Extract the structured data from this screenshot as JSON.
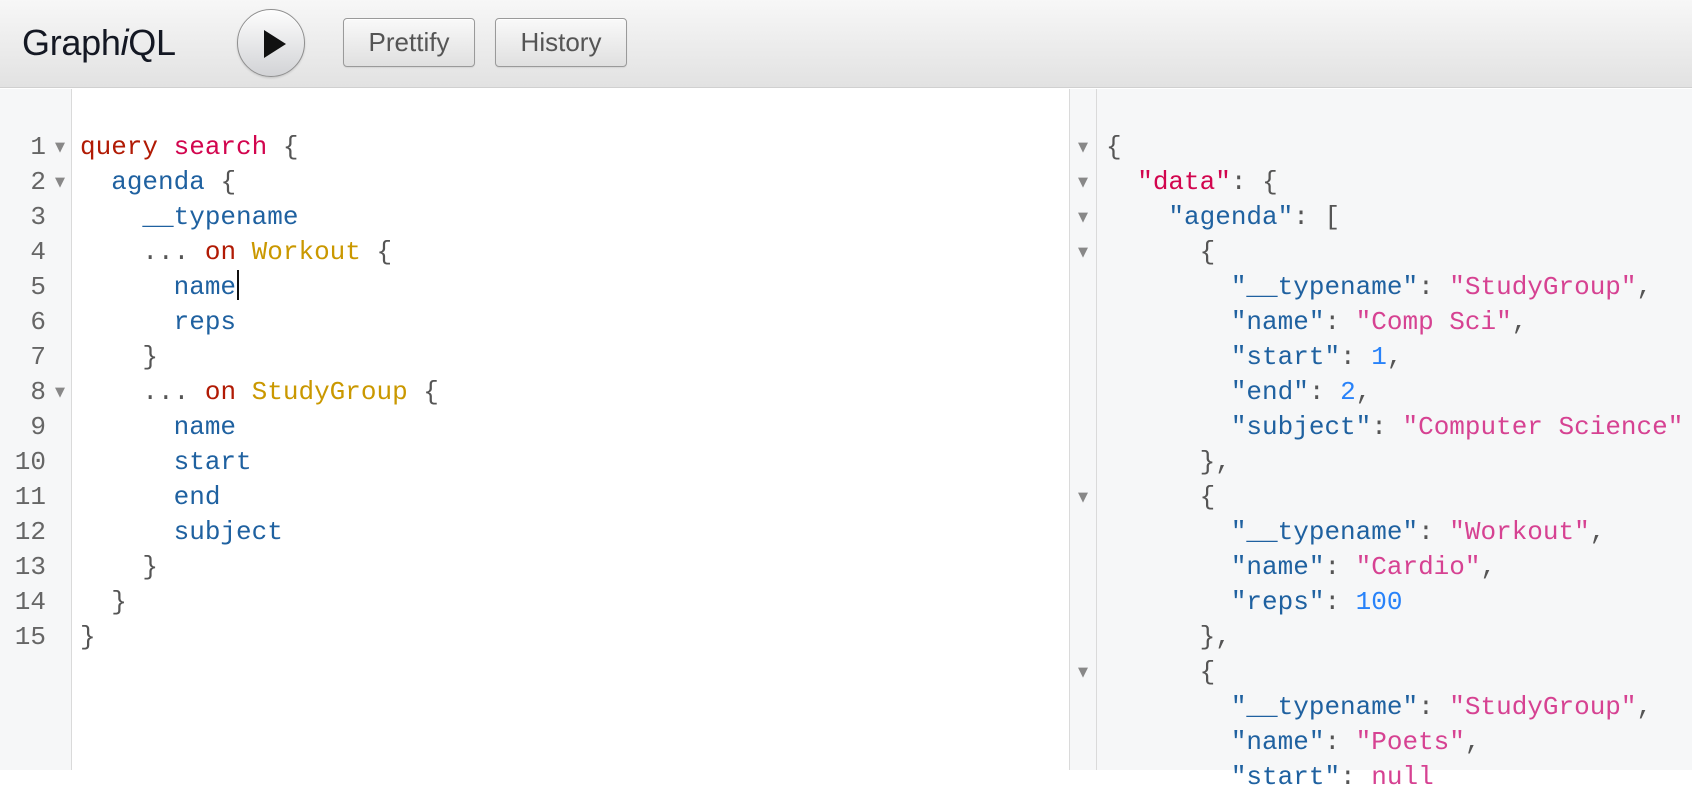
{
  "app": {
    "title_part1": "Graph",
    "title_italic": "i",
    "title_part2": "QL"
  },
  "toolbar": {
    "run_icon": "play-icon",
    "prettify_label": "Prettify",
    "history_label": "History"
  },
  "query_editor": {
    "line_numbers": [
      "1",
      "2",
      "3",
      "4",
      "5",
      "6",
      "7",
      "8",
      "9",
      "10",
      "11",
      "12",
      "13",
      "14",
      "15"
    ],
    "lines": [
      {
        "t1": "query",
        "t2": " ",
        "t3": "search",
        "t4": " {"
      },
      {
        "indent": "  ",
        "field": "agenda",
        "rest": " {"
      },
      {
        "indent": "    ",
        "field": "__typename"
      },
      {
        "indent": "    ",
        "spread": "... ",
        "on": "on",
        "sp": " ",
        "type": "Workout",
        "rest": " {"
      },
      {
        "indent": "      ",
        "field": "name"
      },
      {
        "indent": "      ",
        "field": "reps"
      },
      {
        "indent": "    ",
        "rest": "}"
      },
      {
        "indent": "    ",
        "spread": "... ",
        "on": "on",
        "sp": " ",
        "type": "StudyGroup",
        "rest": " {"
      },
      {
        "indent": "      ",
        "field": "name"
      },
      {
        "indent": "      ",
        "field": "start"
      },
      {
        "indent": "      ",
        "field": "end"
      },
      {
        "indent": "      ",
        "field": "subject"
      },
      {
        "indent": "    ",
        "rest": "}"
      },
      {
        "indent": "  ",
        "rest": "}"
      },
      {
        "rest": "}"
      }
    ]
  },
  "result_viewer": {
    "lines": [
      {
        "rest": "{"
      },
      {
        "indent": "  ",
        "key": "\"data\"",
        "colon": ": ",
        "rest": "{"
      },
      {
        "indent": "    ",
        "key": "\"agenda\"",
        "colon": ": ",
        "rest": "["
      },
      {
        "indent": "      ",
        "rest": "{"
      },
      {
        "indent": "        ",
        "key": "\"__typename\"",
        "colon": ": ",
        "str": "\"StudyGroup\"",
        "rest": ","
      },
      {
        "indent": "        ",
        "key": "\"name\"",
        "colon": ": ",
        "str": "\"Comp Sci\"",
        "rest": ","
      },
      {
        "indent": "        ",
        "key": "\"start\"",
        "colon": ": ",
        "num": "1",
        "rest": ","
      },
      {
        "indent": "        ",
        "key": "\"end\"",
        "colon": ": ",
        "num": "2",
        "rest": ","
      },
      {
        "indent": "        ",
        "key": "\"subject\"",
        "colon": ": ",
        "str": "\"Computer Science\""
      },
      {
        "indent": "      ",
        "rest": "},"
      },
      {
        "indent": "      ",
        "rest": "{"
      },
      {
        "indent": "        ",
        "key": "\"__typename\"",
        "colon": ": ",
        "str": "\"Workout\"",
        "rest": ","
      },
      {
        "indent": "        ",
        "key": "\"name\"",
        "colon": ": ",
        "str": "\"Cardio\"",
        "rest": ","
      },
      {
        "indent": "        ",
        "key": "\"reps\"",
        "colon": ": ",
        "num": "100"
      },
      {
        "indent": "      ",
        "rest": "},"
      },
      {
        "indent": "      ",
        "rest": "{"
      },
      {
        "indent": "        ",
        "key": "\"__typename\"",
        "colon": ": ",
        "str": "\"StudyGroup\"",
        "rest": ","
      },
      {
        "indent": "        ",
        "key": "\"name\"",
        "colon": ": ",
        "str": "\"Poets\"",
        "rest": ","
      },
      {
        "indent": "        ",
        "key": "\"start\"",
        "colon": ": ",
        "str": "null"
      }
    ]
  },
  "colors": {
    "keyword": "#b11a04",
    "definition": "#d2054e",
    "property": "#1f61a0",
    "type": "#ca9800",
    "string": "#d64292",
    "number": "#2882f9"
  }
}
